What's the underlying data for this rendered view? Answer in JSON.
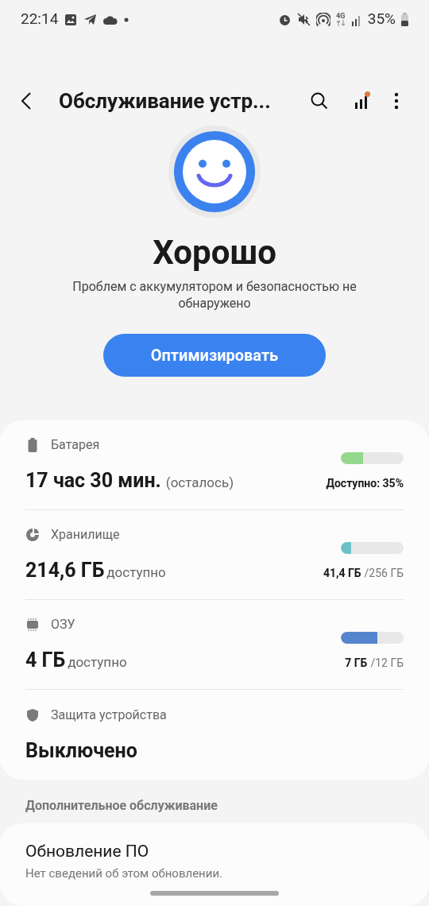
{
  "status_bar": {
    "time": "22:14",
    "battery": "35%",
    "network": "4G"
  },
  "header": {
    "title": "Обслуживание устр..."
  },
  "summary": {
    "status": "Хорошо",
    "message": "Проблем с аккумулятором и безопасностью не обнаружено",
    "button": "Оптимизировать"
  },
  "items": [
    {
      "kind": "battery",
      "label": "Батарея",
      "value": "17 час 30 мин.",
      "value_note": "(осталось)",
      "level": 0.35,
      "color": "#94d88e",
      "detail": "Доступно: 35%"
    },
    {
      "kind": "storage",
      "label": "Хранилище",
      "value": "214,6 ГБ",
      "value_note": "доступно",
      "level": 0.16,
      "color": "#6cc1c8",
      "detail": "41,4 ГБ",
      "detail_note": "/256 ГБ"
    },
    {
      "kind": "ram",
      "label": "ОЗУ",
      "value": "4 ГБ",
      "value_note": "доступно",
      "level": 0.58,
      "color": "#5585cc",
      "detail": "7 ГБ",
      "detail_note": "/12 ГБ"
    },
    {
      "kind": "shield",
      "label": "Защита устройства",
      "value": "Выключено"
    }
  ],
  "more": {
    "heading": "Дополнительное обслуживание",
    "items": [
      {
        "title": "Обновление ПО",
        "subtitle": "Нет сведений об этом обновлении."
      }
    ]
  }
}
